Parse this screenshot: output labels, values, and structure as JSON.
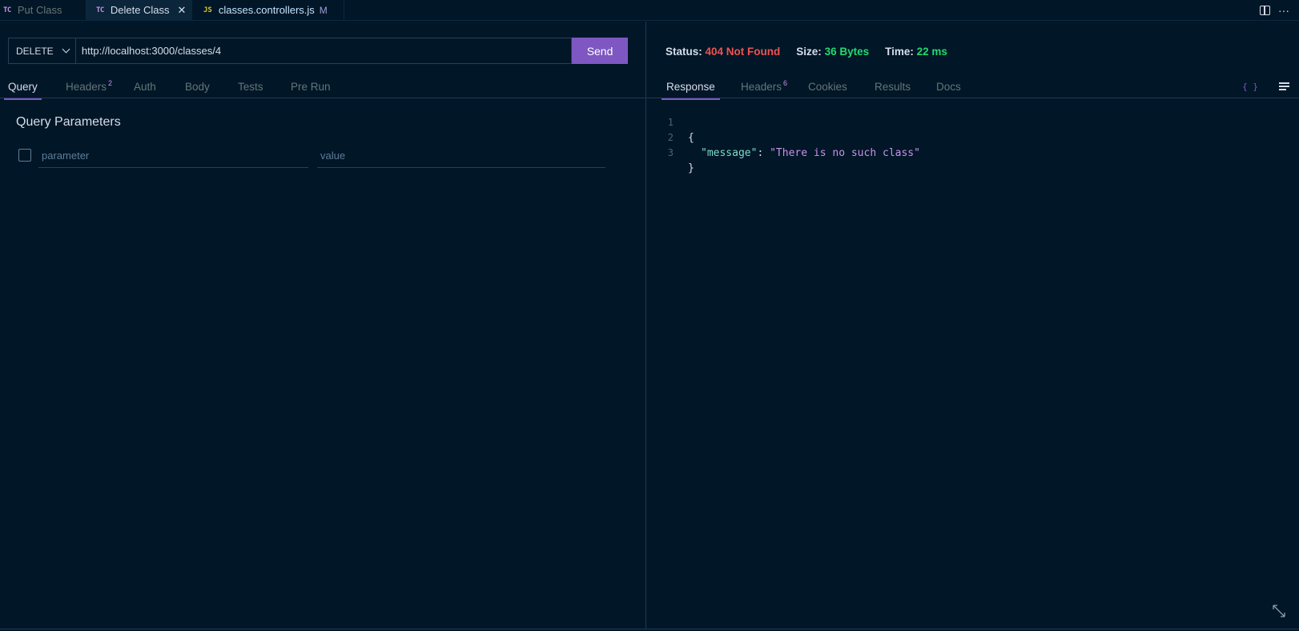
{
  "tabs": [
    {
      "badge": "TC",
      "label": "Put Class"
    },
    {
      "badge": "TC",
      "label": "Delete Class",
      "close": "✕"
    },
    {
      "badge": "JS",
      "label": "classes.controllers.js",
      "modified": "M"
    }
  ],
  "tabbar_actions": {
    "split_icon": "split-editor-icon",
    "more": "···"
  },
  "request": {
    "method": "DELETE",
    "url": "http://localhost:3000/classes/4",
    "send_label": "Send",
    "tabs": {
      "query": "Query",
      "headers": "Headers",
      "headers_count": "2",
      "auth": "Auth",
      "body": "Body",
      "tests": "Tests",
      "pre_run": "Pre Run"
    },
    "query_params": {
      "title": "Query Parameters",
      "param_placeholder": "parameter",
      "value_placeholder": "value"
    }
  },
  "response": {
    "status_label": "Status:",
    "status_value": "404 Not Found",
    "size_label": "Size:",
    "size_value": "36 Bytes",
    "time_label": "Time:",
    "time_value": "22 ms",
    "tabs": {
      "response": "Response",
      "headers": "Headers",
      "headers_count": "6",
      "cookies": "Cookies",
      "results": "Results",
      "docs": "Docs"
    },
    "braces": "{ }",
    "body_lines": [
      {
        "n": "1",
        "text": "{"
      },
      {
        "n": "2",
        "key": "\"message\"",
        "sep": ": ",
        "value": "\"There is no such class\""
      },
      {
        "n": "3",
        "text": "}"
      }
    ]
  },
  "colors": {
    "background": "#011627",
    "accent": "#7e57c2",
    "error": "#ef5350",
    "success": "#22da6e"
  }
}
